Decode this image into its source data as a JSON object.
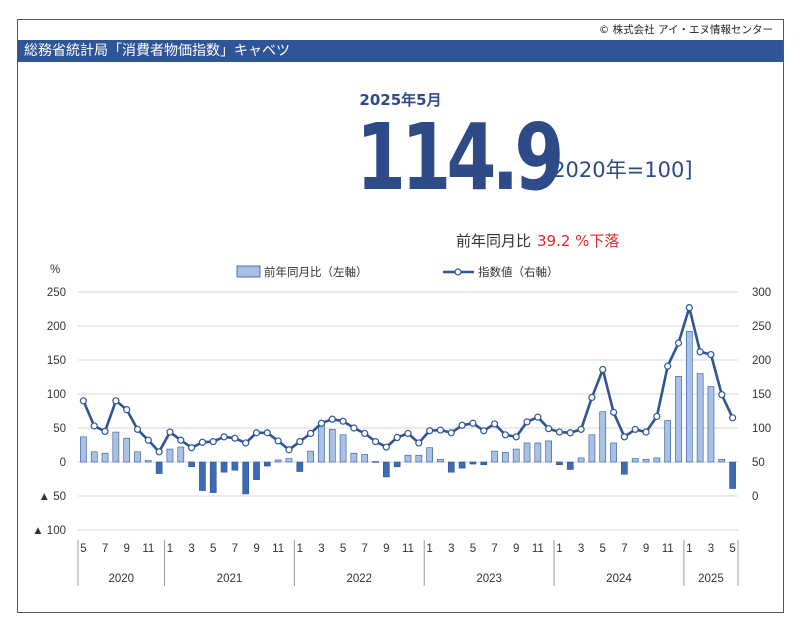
{
  "header": {
    "copyright": "© 株式会社 アイ・エヌ情報センター",
    "title": "総務省統計局「消費者物価指数」キャベツ"
  },
  "summary": {
    "period": "2025年5月",
    "value": "114.9",
    "base_note": "[2020年=100]",
    "yoy_label": "前年同月比",
    "yoy_value": "39.2 %下落"
  },
  "colors": {
    "bar": "#a9c1e6",
    "bar_border": "#2e5597",
    "bar_negative": "#3d6bb6",
    "line": "#2e5597",
    "title_bg": "#2e5597",
    "accent_text": "#2e4a87",
    "negative_text": "#e0262b"
  },
  "chart_data": {
    "type": "bar",
    "y_left_unit": "%",
    "y_left_ticks": [
      "250",
      "200",
      "150",
      "100",
      "50",
      "0",
      "▲ 50",
      "▲ 100"
    ],
    "y_left_lim": [
      -100,
      250
    ],
    "y_right_ticks": [
      "300",
      "250",
      "200",
      "150",
      "100",
      "50",
      "0"
    ],
    "y_right_lim": [
      -50,
      300
    ],
    "grid": true,
    "legend_position": "top-center",
    "x_month_ticks": [
      "5",
      "7",
      "9",
      "11",
      "1",
      "3",
      "5",
      "7",
      "9",
      "11",
      "1",
      "3",
      "5",
      "7",
      "9",
      "11",
      "1",
      "3",
      "5",
      "7",
      "9",
      "11",
      "1",
      "3",
      "5",
      "7",
      "9",
      "11",
      "1",
      "3",
      "5"
    ],
    "x_year_labels": [
      "2020",
      "2021",
      "2022",
      "2023",
      "2024",
      "2025"
    ],
    "x": [
      "2020-05",
      "2020-06",
      "2020-07",
      "2020-08",
      "2020-09",
      "2020-10",
      "2020-11",
      "2020-12",
      "2021-01",
      "2021-02",
      "2021-03",
      "2021-04",
      "2021-05",
      "2021-06",
      "2021-07",
      "2021-08",
      "2021-09",
      "2021-10",
      "2021-11",
      "2021-12",
      "2022-01",
      "2022-02",
      "2022-03",
      "2022-04",
      "2022-05",
      "2022-06",
      "2022-07",
      "2022-08",
      "2022-09",
      "2022-10",
      "2022-11",
      "2022-12",
      "2023-01",
      "2023-02",
      "2023-03",
      "2023-04",
      "2023-05",
      "2023-06",
      "2023-07",
      "2023-08",
      "2023-09",
      "2023-10",
      "2023-11",
      "2023-12",
      "2024-01",
      "2024-02",
      "2024-03",
      "2024-04",
      "2024-05",
      "2024-06",
      "2024-07",
      "2024-08",
      "2024-09",
      "2024-10",
      "2024-11",
      "2024-12",
      "2025-01",
      "2025-02",
      "2025-03",
      "2025-04",
      "2025-05"
    ],
    "series": [
      {
        "name": "前年同月比（左軸）",
        "type": "bar",
        "axis": "left",
        "values": [
          37,
          15,
          13,
          44,
          35,
          15,
          2,
          -17,
          19,
          22,
          -7,
          -42,
          -45,
          -15,
          -12,
          -47,
          -26,
          -6,
          3,
          5,
          -14,
          16,
          55,
          48,
          40,
          13,
          11,
          1,
          -22,
          -7,
          10,
          10,
          21,
          4,
          -15,
          -9,
          -3,
          -4,
          16,
          14,
          19,
          28,
          28,
          31,
          -4,
          -11,
          6,
          40,
          74,
          28,
          -18,
          5,
          4,
          6,
          61,
          126,
          192,
          130,
          111,
          4,
          -39
        ]
      },
      {
        "name": "指数値（右軸）",
        "type": "line",
        "axis": "right",
        "values": [
          140,
          103,
          95,
          140,
          127,
          98,
          82,
          65,
          94,
          82,
          71,
          79,
          80,
          87,
          85,
          78,
          93,
          93,
          81,
          68,
          80,
          92,
          107,
          113,
          110,
          100,
          92,
          80,
          72,
          86,
          92,
          78,
          96,
          97,
          93,
          104,
          107,
          96,
          106,
          90,
          87,
          109,
          116,
          99,
          94,
          93,
          98,
          145,
          186,
          123,
          87,
          98,
          94,
          117,
          191,
          225,
          277,
          212,
          208,
          149,
          115
        ]
      }
    ]
  }
}
